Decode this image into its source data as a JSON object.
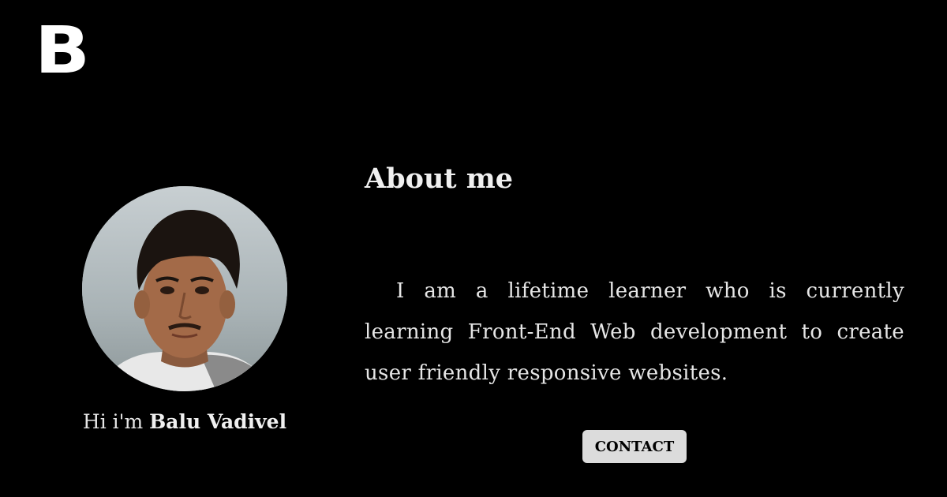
{
  "header": {
    "logo_text": "B"
  },
  "profile": {
    "greeting_prefix": "Hi i'm ",
    "name": "Balu Vadivel"
  },
  "about": {
    "title": "About me",
    "description": "I am a lifetime learner who is currently learning Front-End Web development to create user friendly responsive websites."
  },
  "actions": {
    "contact_label": "CONTACT"
  },
  "colors": {
    "background": "#000000",
    "text": "#e6e6e6",
    "button_bg": "#dcdcdc"
  }
}
